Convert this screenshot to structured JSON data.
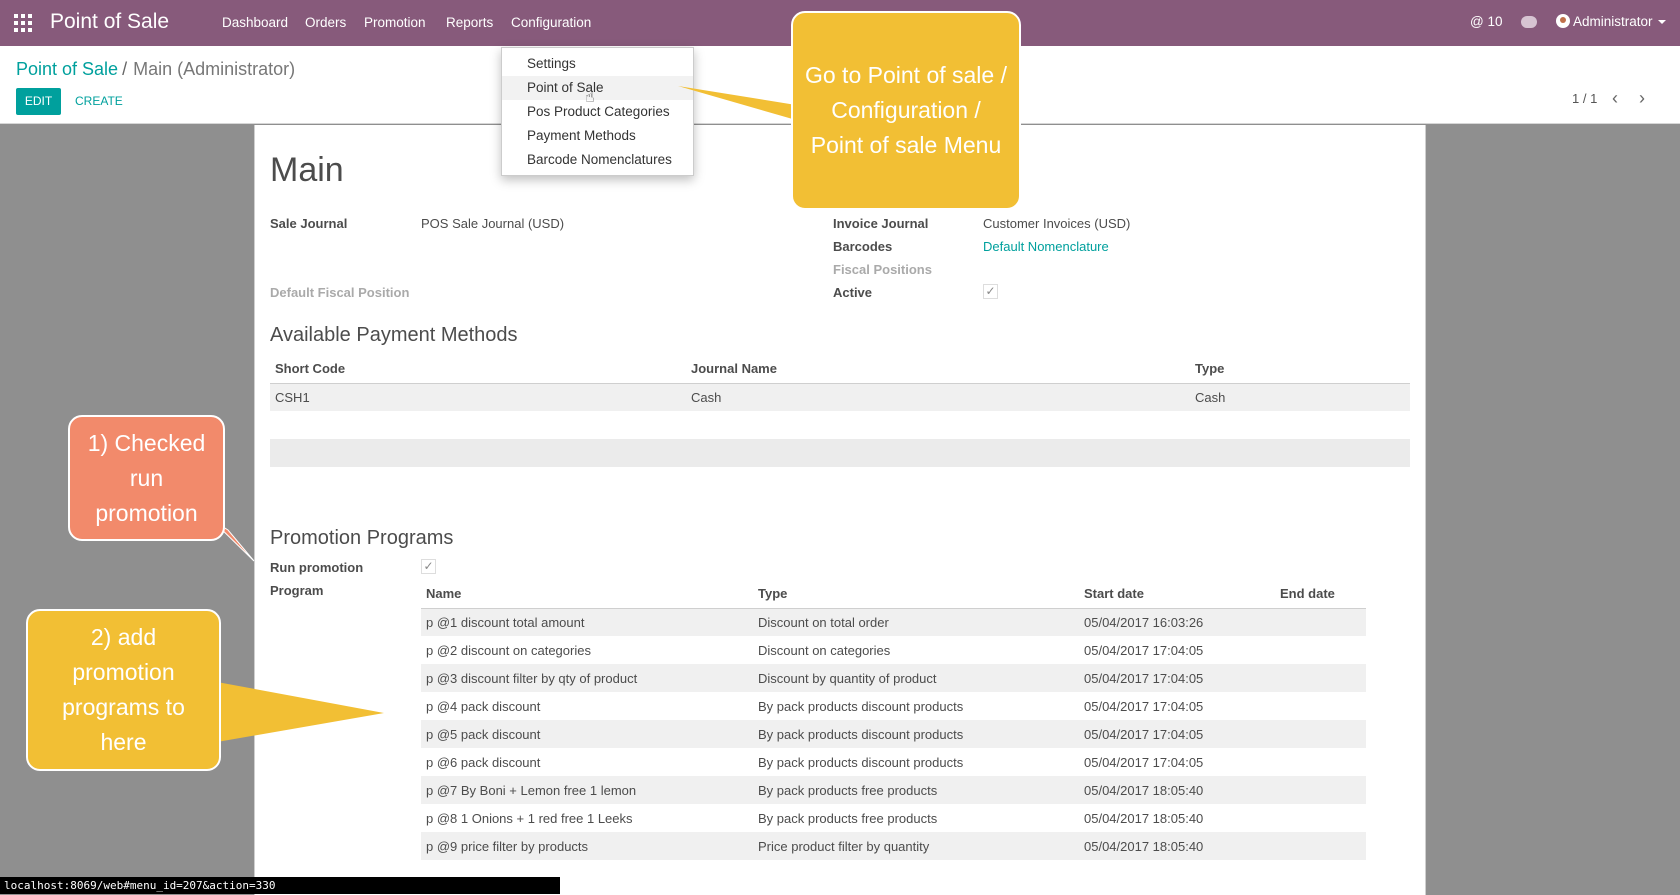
{
  "navbar": {
    "app_title": "Point of Sale",
    "menus": [
      "Dashboard",
      "Orders",
      "Promotion",
      "Reports",
      "Configuration"
    ],
    "notifications": "@ 10",
    "user": "Administrator"
  },
  "breadcrumb": {
    "parent": "Point of Sale",
    "current": "Main (Administrator)"
  },
  "buttons": {
    "edit": "EDIT",
    "create": "CREATE"
  },
  "pager": {
    "text": "1 / 1"
  },
  "config_menu": [
    "Settings",
    "Point of Sale",
    "Pos Product Categories",
    "Payment Methods",
    "Barcode Nomenclatures"
  ],
  "form": {
    "title": "Main",
    "sale_journal_label": "Sale Journal",
    "sale_journal_value": "POS Sale Journal (USD)",
    "invoice_journal_label": "Invoice Journal",
    "invoice_journal_value": "Customer Invoices (USD)",
    "barcodes_label": "Barcodes",
    "barcodes_value": "Default Nomenclature",
    "fiscal_positions_label": "Fiscal Positions",
    "default_fiscal_label": "Default Fiscal Position",
    "active_label": "Active",
    "payment_section": "Available Payment Methods",
    "payment_headers": [
      "Short Code",
      "Journal Name",
      "Type"
    ],
    "payment_rows": [
      [
        "CSH1",
        "Cash",
        "Cash"
      ]
    ],
    "promotion_section": "Promotion Programs",
    "run_promotion_label": "Run promotion",
    "program_label": "Program",
    "program_headers": [
      "Name",
      "Type",
      "Start date",
      "End date"
    ],
    "program_rows": [
      [
        "p @1 discount total amount",
        "Discount on total order",
        "05/04/2017 16:03:26",
        ""
      ],
      [
        "p @2 discount on categories",
        "Discount on categories",
        "05/04/2017 17:04:05",
        ""
      ],
      [
        "p @3 discount filter by qty of product",
        "Discount by quantity of product",
        "05/04/2017 17:04:05",
        ""
      ],
      [
        "p @4 pack discount",
        "By pack products discount products",
        "05/04/2017 17:04:05",
        ""
      ],
      [
        "p @5 pack discount",
        "By pack products discount products",
        "05/04/2017 17:04:05",
        ""
      ],
      [
        "p @6 pack discount",
        "By pack products discount products",
        "05/04/2017 17:04:05",
        ""
      ],
      [
        "p @7 By Boni + Lemon free 1 lemon",
        "By pack products free products",
        "05/04/2017 18:05:40",
        ""
      ],
      [
        "p @8 1 Onions + 1 red free 1 Leeks",
        "By pack products free products",
        "05/04/2017 18:05:40",
        ""
      ],
      [
        "p @9 price filter by products",
        "Price product filter by quantity",
        "05/04/2017 18:05:40",
        ""
      ]
    ]
  },
  "callouts": {
    "config_hint": "Go to Point of sale / Configuration / Point of sale Menu",
    "run_promotion_hint": "1) Checked run promotion",
    "add_programs_hint": "2) add promotion programs to here"
  },
  "status_url": "localhost:8069/web#menu_id=207&action=330",
  "colors": {
    "navbar": "#875a7b",
    "accent": "#00a09d",
    "callout_yellow": "#f2bf34",
    "callout_orange": "#f28a6b"
  }
}
